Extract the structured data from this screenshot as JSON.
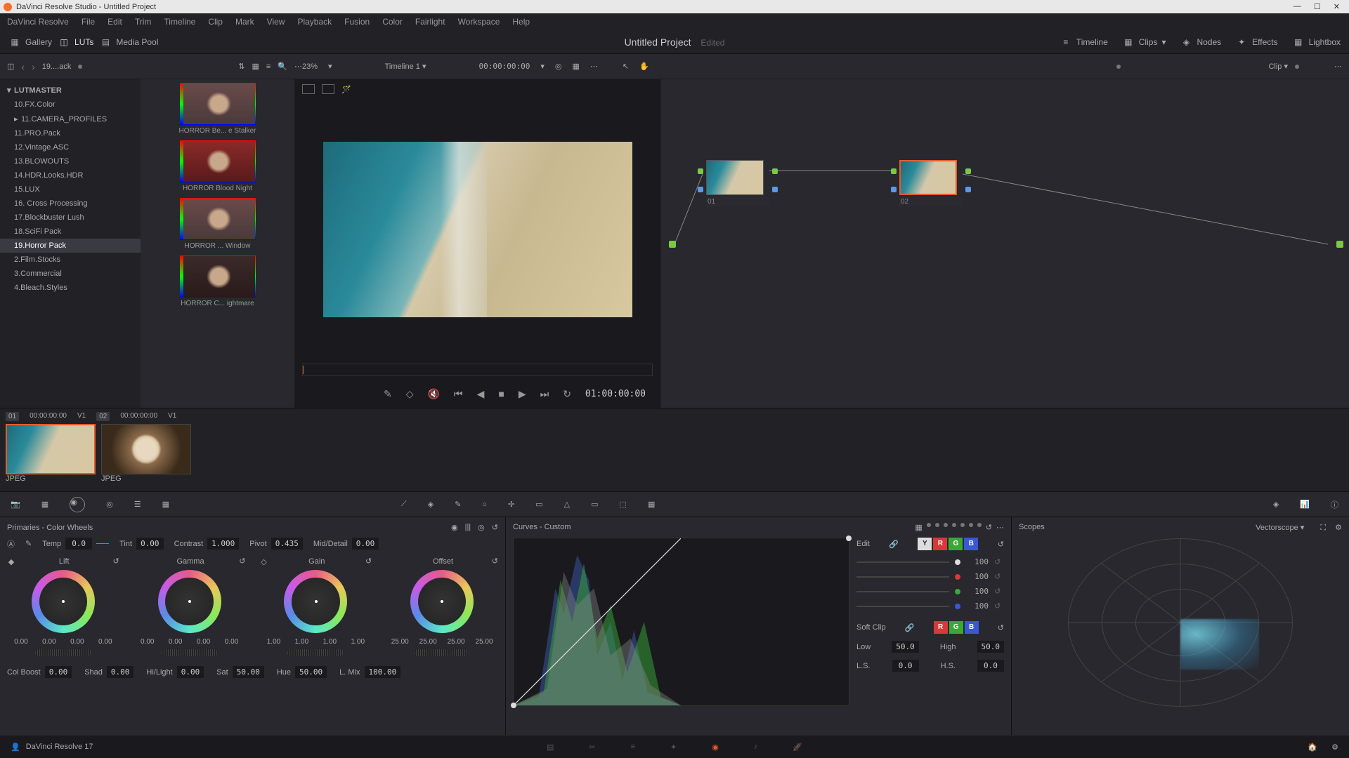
{
  "titlebar": {
    "text": "DaVinci Resolve Studio - Untitled Project"
  },
  "menu": [
    "DaVinci Resolve",
    "File",
    "Edit",
    "Trim",
    "Timeline",
    "Clip",
    "Mark",
    "View",
    "Playback",
    "Fusion",
    "Color",
    "Fairlight",
    "Workspace",
    "Help"
  ],
  "toolbar": {
    "gallery": "Gallery",
    "luts": "LUTs",
    "mediapool": "Media Pool",
    "project": "Untitled Project",
    "edited": "Edited",
    "timeline": "Timeline",
    "clips": "Clips",
    "nodes": "Nodes",
    "effects": "Effects",
    "lightbox": "Lightbox"
  },
  "subtoolbar": {
    "breadcrumb": "19....ack",
    "zoom": "23%",
    "timeline_name": "Timeline 1",
    "timecode_in": "00:00:00:00",
    "clip_mode": "Clip"
  },
  "luts_tree": {
    "root": "LUTMASTER",
    "items": [
      "10.FX.Color",
      "11.CAMERA_PROFILES",
      "11.PRO.Pack",
      "12.Vintage.ASC",
      "13.BLOWOUTS",
      "14.HDR.Looks.HDR",
      "15.LUX",
      "16. Cross Processing",
      "17.Blockbuster Lush",
      "18.SciFi Pack",
      "19.Horror Pack",
      "2.Film.Stocks",
      "3.Commercial",
      "4.Bleach.Styles"
    ],
    "active_index": 10
  },
  "lut_thumbs": [
    "HORROR Be... e Stalker",
    "HORROR Blood Night",
    "HORROR ... Window",
    "HORROR C... ightmare"
  ],
  "viewer": {
    "timecode": "01:00:00:00"
  },
  "nodes": [
    {
      "label": "01"
    },
    {
      "label": "02"
    }
  ],
  "clips": {
    "info1_num": "01",
    "info1_tc": "00:00:00:00",
    "info1_track": "V1",
    "info2_num": "02",
    "info2_tc": "00:00:00:00",
    "info2_track": "V1",
    "label1": "JPEG",
    "label2": "JPEG"
  },
  "primaries": {
    "title": "Primaries - Color Wheels",
    "temp_label": "Temp",
    "temp": "0.0",
    "tint_label": "Tint",
    "tint": "0.00",
    "contrast_label": "Contrast",
    "contrast": "1.000",
    "pivot_label": "Pivot",
    "pivot": "0.435",
    "md_label": "Mid/Detail",
    "md": "0.00",
    "wheels": [
      {
        "name": "Lift",
        "vals": [
          "0.00",
          "0.00",
          "0.00",
          "0.00"
        ]
      },
      {
        "name": "Gamma",
        "vals": [
          "0.00",
          "0.00",
          "0.00",
          "0.00"
        ]
      },
      {
        "name": "Gain",
        "vals": [
          "1.00",
          "1.00",
          "1.00",
          "1.00"
        ]
      },
      {
        "name": "Offset",
        "vals": [
          "25.00",
          "25.00",
          "25.00",
          "25.00"
        ]
      }
    ],
    "colboost_label": "Col Boost",
    "colboost": "0.00",
    "shad_label": "Shad",
    "shad": "0.00",
    "hilight_label": "Hi/Light",
    "hilight": "0.00",
    "sat_label": "Sat",
    "sat": "50.00",
    "hue_label": "Hue",
    "hue": "50.00",
    "lmix_label": "L. Mix",
    "lmix": "100.00"
  },
  "curves": {
    "title": "Curves - Custom",
    "edit_label": "Edit",
    "channel_vals": [
      "100",
      "100",
      "100",
      "100"
    ],
    "softclip_label": "Soft Clip",
    "low_label": "Low",
    "low": "50.0",
    "high_label": "High",
    "high": "50.0",
    "ls_label": "L.S.",
    "ls": "0.0",
    "hs_label": "H.S.",
    "hs": "0.0"
  },
  "scopes": {
    "title": "Scopes",
    "mode": "Vectorscope"
  },
  "status": {
    "app": "DaVinci Resolve 17"
  }
}
